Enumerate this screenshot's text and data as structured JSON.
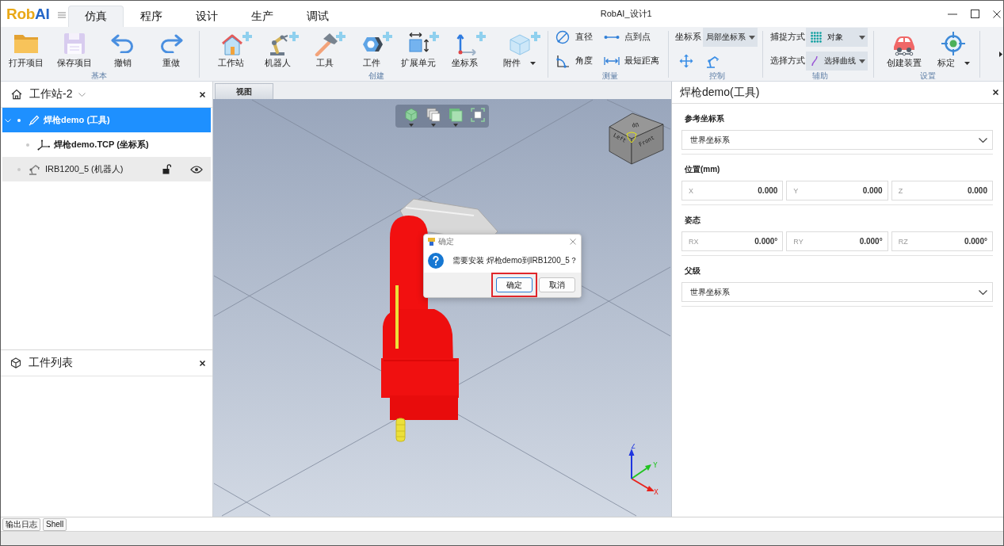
{
  "window": {
    "title": "RobAI_设计1"
  },
  "logo": [
    {
      "text": "Rob",
      "color": "#e9a816"
    },
    {
      "text": "AI",
      "color": "#2466c8"
    }
  ],
  "menu_tabs": [
    {
      "label": "仿真",
      "selected": true
    },
    {
      "label": "程序",
      "selected": false
    },
    {
      "label": "设计",
      "selected": false
    },
    {
      "label": "生产",
      "selected": false
    },
    {
      "label": "调试",
      "selected": false
    }
  ],
  "ribbon": [
    {
      "label": "基本",
      "kind": "row",
      "items": [
        {
          "kind": "large",
          "label": "打开项目",
          "menu": false
        },
        {
          "kind": "large",
          "label": "保存项目",
          "menu": false
        },
        {
          "kind": "large",
          "label": "撤销",
          "menu": false
        },
        {
          "kind": "large",
          "label": "重做",
          "menu": false
        }
      ]
    },
    {
      "label": "创建",
      "kind": "row",
      "items": [
        {
          "kind": "large",
          "label": "工作站",
          "menu": false
        },
        {
          "kind": "large",
          "label": "机器人",
          "menu": false
        },
        {
          "kind": "large",
          "label": "工具",
          "menu": false
        },
        {
          "kind": "large",
          "label": "工件",
          "menu": false
        },
        {
          "kind": "large",
          "label": "扩展单元",
          "menu": false
        },
        {
          "kind": "large",
          "label": "坐标系",
          "menu": false
        },
        {
          "kind": "large",
          "label": "附件",
          "menu": true
        }
      ]
    },
    {
      "label": "测量",
      "kind": "grid",
      "items": [
        {
          "kind": "small",
          "label": "直径"
        },
        {
          "kind": "small",
          "label": "点到点"
        },
        {
          "kind": "small",
          "label": "角度"
        },
        {
          "kind": "small",
          "label": "最短距离"
        }
      ]
    },
    {
      "label": "控制",
      "kind": "stack",
      "items": [
        {
          "kind": "combo",
          "label": "坐标系",
          "value": "局部坐标系"
        },
        {
          "kind": "tools"
        }
      ]
    },
    {
      "label": "辅助",
      "kind": "stack",
      "items": [
        {
          "kind": "combo",
          "label": "捕捉方式",
          "value": "对象"
        },
        {
          "kind": "combo",
          "label": "选择方式",
          "value": "选择曲线"
        }
      ]
    },
    {
      "label": "设置",
      "kind": "row",
      "items": [
        {
          "kind": "large",
          "label": "创建装置",
          "menu": false
        },
        {
          "kind": "large",
          "label": "标定",
          "menu": true
        }
      ]
    }
  ],
  "station_panel": {
    "title": "工作站-2",
    "tree": [
      {
        "kind": "tool",
        "label": "焊枪demo (工具)",
        "selected": true,
        "hovered": false,
        "expanded": true,
        "children": [
          {
            "kind": "frame",
            "label": "焊枪demo.TCP (坐标系)",
            "selected": false,
            "hovered": false
          }
        ]
      },
      {
        "kind": "robot",
        "label": "IRB1200_5 (机器人)",
        "selected": false,
        "hovered": true,
        "locked": false,
        "visible": true
      }
    ]
  },
  "workpiece_panel": {
    "title": "工件列表"
  },
  "viewport": {
    "tab": "视图",
    "view_cube": {
      "faces": [
        "Up",
        "Left",
        "Front"
      ]
    },
    "axes": [
      {
        "label": "X",
        "color": "#e8221c"
      },
      {
        "label": "Y",
        "color": "#21c321"
      },
      {
        "label": "Z",
        "color": "#1f35e0"
      }
    ]
  },
  "dialog": {
    "title": "确定",
    "message": "需要安装 焊枪demo到IRB1200_5？",
    "buttons": [
      {
        "label": "确定",
        "focused": true,
        "highlighted": true
      },
      {
        "label": "取消",
        "focused": false,
        "highlighted": false
      }
    ]
  },
  "properties": {
    "title": "焊枪demo(工具)",
    "sections": [
      {
        "kind": "select",
        "label": "参考坐标系",
        "value": "世界坐标系"
      },
      {
        "kind": "fields",
        "label": "位置(mm)",
        "fields": [
          {
            "label": "X",
            "value": "0.000"
          },
          {
            "label": "Y",
            "value": "0.000"
          },
          {
            "label": "Z",
            "value": "0.000"
          }
        ]
      },
      {
        "kind": "fields",
        "label": "姿态",
        "fields": [
          {
            "label": "RX",
            "value": "0.000°"
          },
          {
            "label": "RY",
            "value": "0.000°"
          },
          {
            "label": "RZ",
            "value": "0.000°"
          }
        ]
      },
      {
        "kind": "select",
        "label": "父级",
        "value": "世界坐标系"
      }
    ]
  },
  "bottom_tabs": [
    {
      "label": "输出日志"
    },
    {
      "label": "Shell"
    }
  ]
}
